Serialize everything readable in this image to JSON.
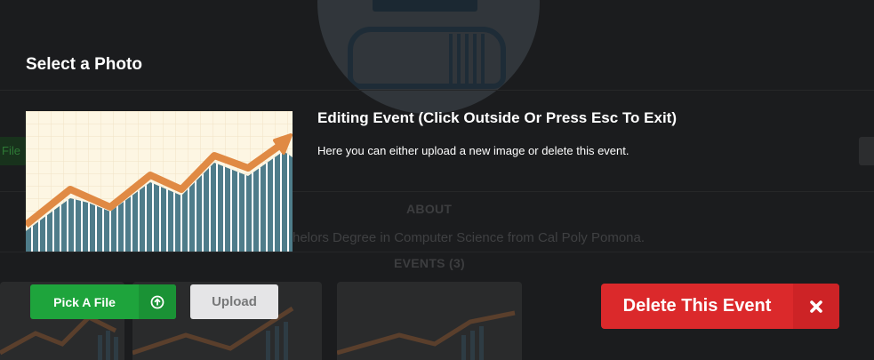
{
  "background": {
    "side_button_label": "File",
    "about_heading": "ABOUT",
    "about_text": "helors Degree in Computer Science from Cal Poly Pomona.",
    "events_heading": "EVENTS (3)"
  },
  "modal": {
    "select_title": "Select a Photo",
    "event_title": "Editing Event (Click Outside Or Press Esc To Exit)",
    "event_description": "Here you can either upload a new image or delete this event.",
    "pick_file_label": "Pick A File",
    "pick_file_icon": "upload-circle-icon",
    "upload_label": "Upload",
    "delete_label": "Delete This Event",
    "delete_icon": "close-icon"
  },
  "colors": {
    "pick_green": "#1ea43c",
    "delete_red": "#db292b",
    "upload_gray": "#e5e5e7",
    "chart_bars": "#4e7c8a",
    "chart_arrow": "#e08a44",
    "chart_bg": "#fdf6e3"
  }
}
